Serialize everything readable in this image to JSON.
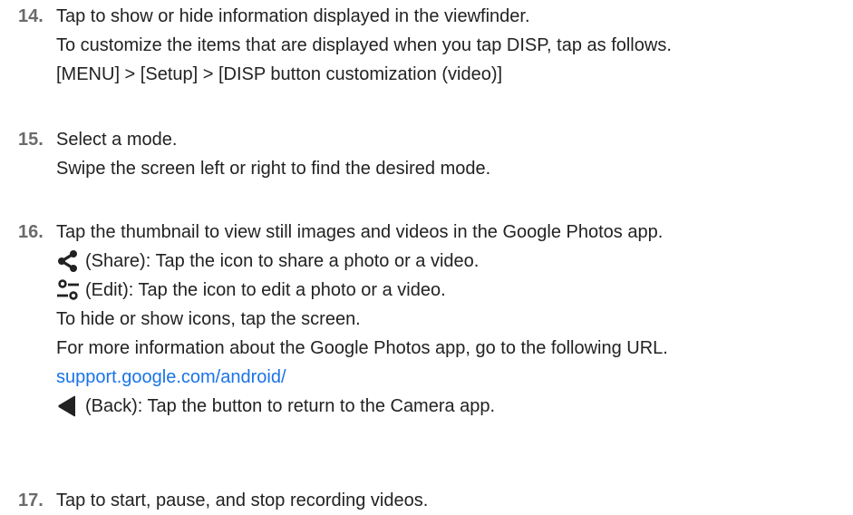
{
  "items": [
    {
      "number": "14.",
      "title": "Tap to show or hide information displayed in the viewfinder.",
      "lines": [
        "To customize the items that are displayed when you tap DISP, tap as follows.",
        "[MENU] > [Setup] > [DISP button customization (video)]"
      ]
    },
    {
      "number": "15.",
      "title": "Select a mode.",
      "lines": [
        "Swipe the screen left or right to find the desired mode."
      ]
    },
    {
      "number": "16.",
      "title": "Tap the thumbnail to view still images and videos in the Google Photos app.",
      "share_text": "(Share): Tap the icon to share a photo or a video.",
      "edit_text": "(Edit): Tap the icon to edit a photo or a video.",
      "hide_text": "To hide or show icons, tap the screen.",
      "more_text": "For more information about the Google Photos app, go to the following URL.",
      "link_text": "support.google.com/android/",
      "back_text": "(Back): Tap the button to return to the Camera app."
    },
    {
      "number": "17.",
      "title": "Tap to start, pause, and stop recording videos."
    }
  ],
  "icons": {
    "share": "share-icon",
    "edit": "edit-icon",
    "back": "back-triangle-icon"
  },
  "colors": {
    "text": "#222222",
    "number": "#6b6b6b",
    "link": "#1a73e8"
  }
}
